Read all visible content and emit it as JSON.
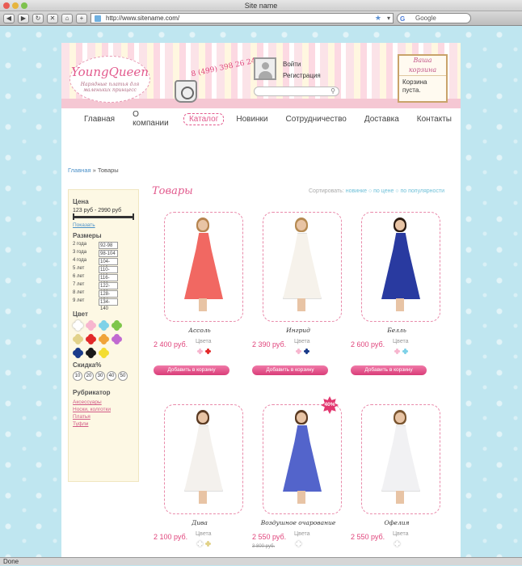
{
  "browser": {
    "window_title": "Site name",
    "url": "http://www.sitename.com/",
    "search_placeholder": "Google",
    "status": "Done"
  },
  "header": {
    "logo_name": "YoungQueen",
    "logo_tagline": "Нарядные платья для маленьких принцесс",
    "phone": "8 (499) 398 26 24",
    "login": "Войти",
    "register": "Регистрация",
    "cart_title": "Ваша корзина",
    "cart_message": "Корзина пуста."
  },
  "nav": [
    "Главная",
    "О компании",
    "Каталог",
    "Новинки",
    "Сотрудничество",
    "Доставка",
    "Контакты"
  ],
  "breadcrumb": {
    "home": "Главная",
    "sep": " » ",
    "current": "Товары"
  },
  "sidebar": {
    "price_title": "Цена",
    "price_range": "123 руб - 2990 руб",
    "show_link": "Показать",
    "sizes_title": "Размеры",
    "sizes": [
      {
        "age": "2 года",
        "size": "92-98"
      },
      {
        "age": "3 года",
        "size": "98-104"
      },
      {
        "age": "4 года",
        "size": "104-110"
      },
      {
        "age": "5 лет",
        "size": "110-116"
      },
      {
        "age": "6 лет",
        "size": "116-122"
      },
      {
        "age": "7 лет",
        "size": "122-128"
      },
      {
        "age": "8 лет",
        "size": "128-134"
      },
      {
        "age": "9 лет",
        "size": "134-140"
      }
    ],
    "color_title": "Цвет",
    "colors": [
      "#ffffff",
      "#f7b6cf",
      "#7fd2e8",
      "#7ec64a",
      "#e2d28a",
      "#e22a2a",
      "#f0a43a",
      "#c16ad1",
      "#1a3b8a",
      "#1a1a1a",
      "#f3dd32"
    ],
    "discount_title": "Скидка%",
    "discounts": [
      "10",
      "20",
      "30",
      "40",
      "50"
    ],
    "rubricator_title": "Рубрикатор",
    "rubrics": [
      "Аксессуары",
      "Носки, колготки",
      "Платья",
      "Туфли"
    ]
  },
  "catalog": {
    "title": "Товары",
    "sort_label": "Сортировать:",
    "sort_options": "новинке ○ по цене ○ по популярности",
    "colors_label": "Цвета",
    "add_button": "Добавить в корзину",
    "products": [
      {
        "name": "Ассоль",
        "price": "2 400 руб.",
        "old_price": "",
        "badge": "",
        "dress": "#f0605a",
        "hair": "#b6844f",
        "swatches": [
          "#f7b6cf",
          "#e22a2a"
        ]
      },
      {
        "name": "Ингрид",
        "price": "2 390 руб.",
        "old_price": "",
        "badge": "",
        "dress": "#f6f2ea",
        "hair": "#b58a52",
        "swatches": [
          "#f7b6cf",
          "#1a3b8a"
        ]
      },
      {
        "name": "Белль",
        "price": "2 600 руб.",
        "old_price": "",
        "badge": "",
        "dress": "#1d2f9b",
        "hair": "#2a1a10",
        "swatches": [
          "#f7b6cf",
          "#7fd2e8"
        ]
      },
      {
        "name": "Дива",
        "price": "2 100 руб.",
        "old_price": "",
        "badge": "",
        "dress": "#f4f1ec",
        "hair": "#5a3a22",
        "swatches": [
          "#ffffff",
          "#e2d28a"
        ]
      },
      {
        "name": "Воздушное очарование",
        "price": "2 550 руб.",
        "old_price": "3 800 руб.",
        "badge": "40%",
        "dress": "#4a5cc8",
        "hair": "#5a3a22",
        "swatches": [
          "#ffffff"
        ]
      },
      {
        "name": "Офелия",
        "price": "2 550 руб.",
        "old_price": "",
        "badge": "",
        "dress": "#f1f1f3",
        "hair": "#7a5530",
        "swatches": [
          "#ffffff"
        ]
      }
    ]
  }
}
